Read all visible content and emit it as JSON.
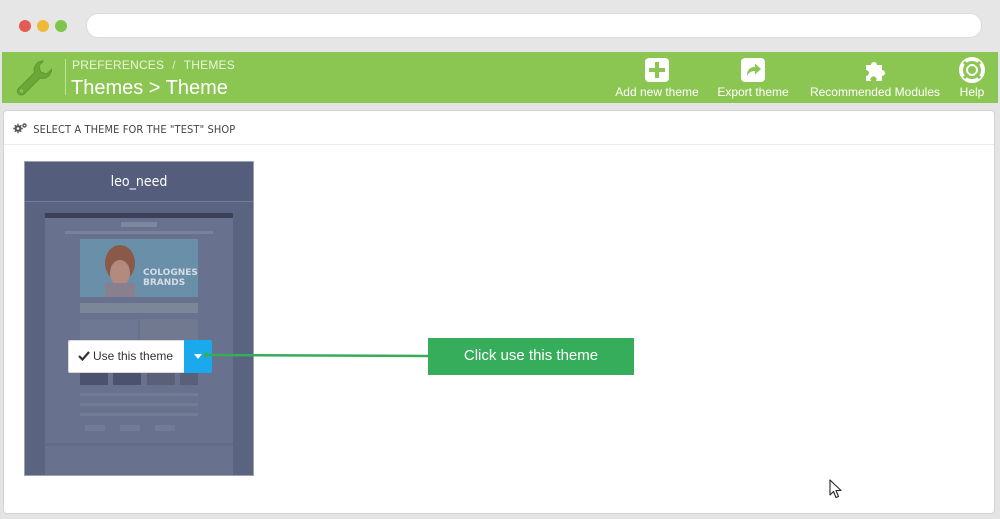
{
  "breadcrumb": {
    "level1": "PREFERENCES",
    "separator": "/",
    "level2": "THEMES"
  },
  "page_title": "Themes > Theme",
  "toolbar": {
    "add_new_theme": "Add new theme",
    "export_theme": "Export theme",
    "recommended_modules": "Recommended Modules",
    "help": "Help"
  },
  "panel": {
    "heading": "SELECT A THEME FOR THE \"TEST\" SHOP"
  },
  "theme": {
    "name": "leo_need",
    "use_label": "Use this theme"
  },
  "callout": {
    "text": "Click use this theme"
  },
  "colors": {
    "toolbar": "#8cc652",
    "theme_card": "#545d7c",
    "caret_button": "#19a9ec",
    "callout": "#36ad5b"
  },
  "icons": {
    "toolbar": [
      "wrench-icon",
      "plus-square-icon",
      "share-icon",
      "puzzle-icon",
      "lifebuoy-icon"
    ],
    "heading": "cogs-icon",
    "use_button": "check-icon",
    "dropdown": "caret-down-icon"
  }
}
